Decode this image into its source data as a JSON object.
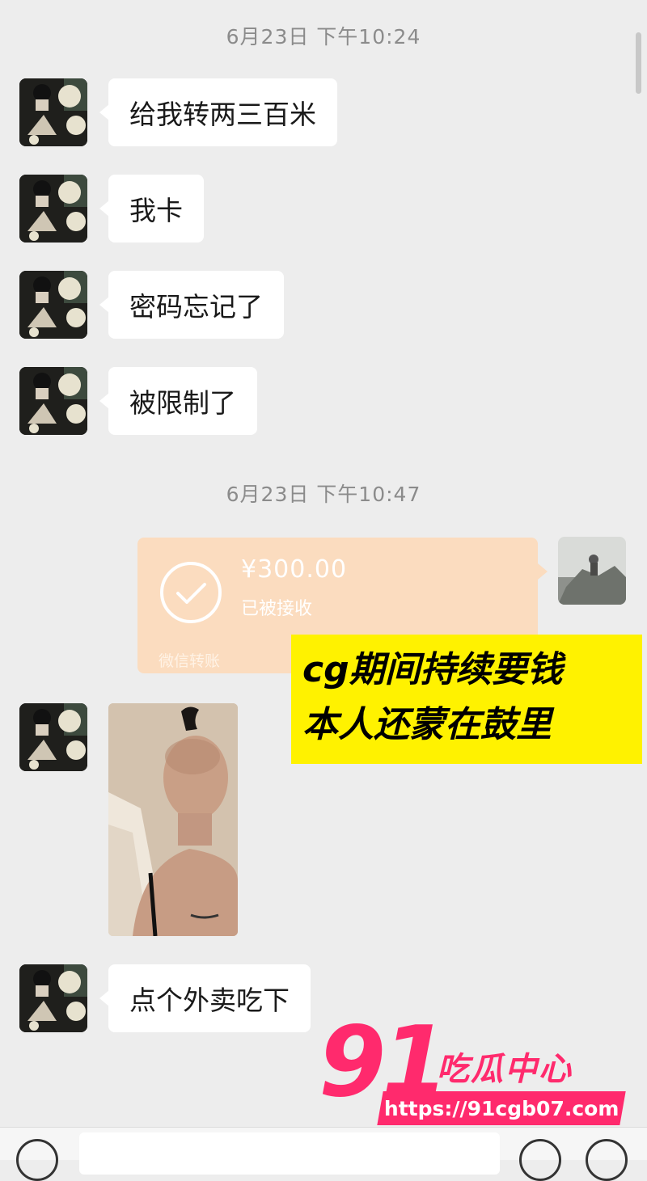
{
  "chat": {
    "timestamps": [
      "6月23日 下午10:24",
      "6月23日 下午10:47"
    ],
    "incoming": [
      "给我转两三百米",
      "我卡",
      "密码忘记了",
      "被限制了",
      "点个外卖吃下"
    ],
    "transfer": {
      "amount": "¥300.00",
      "status": "已被接收",
      "footer": "微信转账"
    }
  },
  "overlay": {
    "caption_line1": "cg期间持续要钱",
    "caption_line2": "本人还蒙在鼓里",
    "watermark_number": "91",
    "watermark_text": "吃瓜中心",
    "watermark_url": "https://91cgb07.com"
  },
  "colors": {
    "background": "#ededed",
    "bubble": "#ffffff",
    "transfer_card": "#fbdcbf",
    "caption_bg": "#fff200",
    "watermark": "#ff2a6d"
  },
  "icons": [
    "voice-icon",
    "emoji-icon",
    "plus-icon",
    "check-circle-icon"
  ]
}
